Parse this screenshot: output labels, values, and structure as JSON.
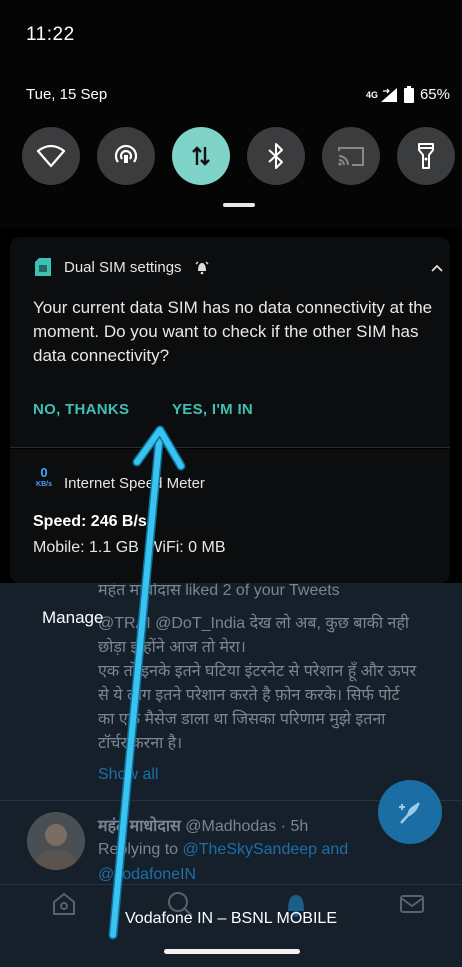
{
  "status_bar": {
    "time": "11:22",
    "date": "Tue, 15 Sep",
    "network": "4G",
    "battery": "65%"
  },
  "quick_tiles": [
    {
      "name": "wifi-tile",
      "icon": "wifi-icon"
    },
    {
      "name": "hotspot-tile",
      "icon": "hotspot-icon"
    },
    {
      "name": "mobile-data-tile",
      "icon": "data-arrows-icon"
    },
    {
      "name": "bluetooth-tile",
      "icon": "bluetooth-icon"
    },
    {
      "name": "cast-tile",
      "icon": "cast-icon"
    },
    {
      "name": "flashlight-tile",
      "icon": "flashlight-icon"
    }
  ],
  "notifications": {
    "dual_sim": {
      "title": "Dual SIM settings",
      "body": "Your current data SIM has no data connectivity at the moment. Do you want to check if the other SIM has data connectivity?",
      "action_no": "NO, THANKS",
      "action_yes": "YES, I'M IN"
    },
    "speed_meter": {
      "icon_top": "0",
      "icon_bottom": "KB/s",
      "title": "Internet Speed Meter",
      "speed": "Speed: 246 B/s",
      "mobile": "Mobile: 1.1 GB",
      "wifi": "WiFi: 0 MB"
    }
  },
  "manage_label": "Manage",
  "background_app": {
    "notice": "महंत माधोदास liked 2 of your Tweets",
    "tweet_line1": "@TRAI @DoT_India देख लो अब, कुछ बाकी नही",
    "tweet_line2": "छोड़ा इन्होंने आज तो मेरा।",
    "tweet_line3": "एक तो इनके इतने घटिया इंटरनेट से परेशान हूँ और ऊपर",
    "tweet_line4": "से ये लोग इतने परेशान करते है फ़ोन करके। सिर्फ पोर्ट",
    "tweet_line5": "का एक मैसेज डाला था जिसका परिणाम मुझे इतना",
    "tweet_line6": "टॉर्चर करना है।",
    "show_all": "Show all",
    "author_name": "महंत माधोदास",
    "author_handle": "@Madhodas",
    "time_ago": "· 5h",
    "reply_prefix": "Replying to",
    "reply_handles": "@TheSkySandeep and",
    "reply_more": "@vodafoneIN"
  },
  "carrier_label": "Vodafone IN – BSNL MOBILE",
  "colors": {
    "accent": "#3ec1b5",
    "tile_active": "#7fd3c8",
    "tile": "#3a3c3e",
    "twitter_bg": "#15202b",
    "twitter_blue": "#1da1f2"
  }
}
